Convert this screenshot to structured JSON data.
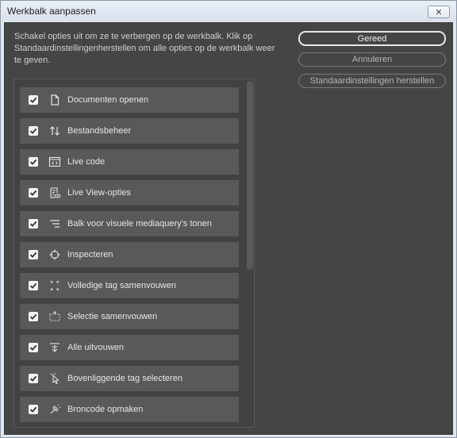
{
  "window": {
    "title": "Werkbalk aanpassen",
    "close_glyph": "✕"
  },
  "description": "Schakel opties uit om ze te verbergen op de werkbalk. Klik op Standaardinstellingenherstellen om alle opties op de werkbalk weer te geven.",
  "buttons": {
    "done": "Gereed",
    "cancel": "Annuleren",
    "restore_defaults": "Standaardinstellingen herstellen"
  },
  "toolbar_options": [
    {
      "label": "Documenten openen",
      "icon": "document-icon",
      "checked": true
    },
    {
      "label": "Bestandsbeheer",
      "icon": "file-management-icon",
      "checked": true
    },
    {
      "label": "Live code",
      "icon": "live-code-icon",
      "checked": true
    },
    {
      "label": "Live View-opties",
      "icon": "live-view-options-icon",
      "checked": true
    },
    {
      "label": "Balk voor visuele mediaquery's tonen",
      "icon": "media-query-bar-icon",
      "checked": true
    },
    {
      "label": "Inspecteren",
      "icon": "inspect-icon",
      "checked": true
    },
    {
      "label": "Volledige tag samenvouwen",
      "icon": "collapse-full-tag-icon",
      "checked": true
    },
    {
      "label": "Selectie samenvouwen",
      "icon": "collapse-selection-icon",
      "checked": true
    },
    {
      "label": "Alle uitvouwen",
      "icon": "expand-all-icon",
      "checked": true
    },
    {
      "label": "Bovenliggende tag selecteren",
      "icon": "select-parent-tag-icon",
      "checked": true
    },
    {
      "label": "Broncode opmaken",
      "icon": "format-source-icon",
      "checked": true
    }
  ],
  "colors": {
    "panel_bg": "#454545",
    "item_bg": "#595959",
    "item_text": "#e6e6e6"
  }
}
